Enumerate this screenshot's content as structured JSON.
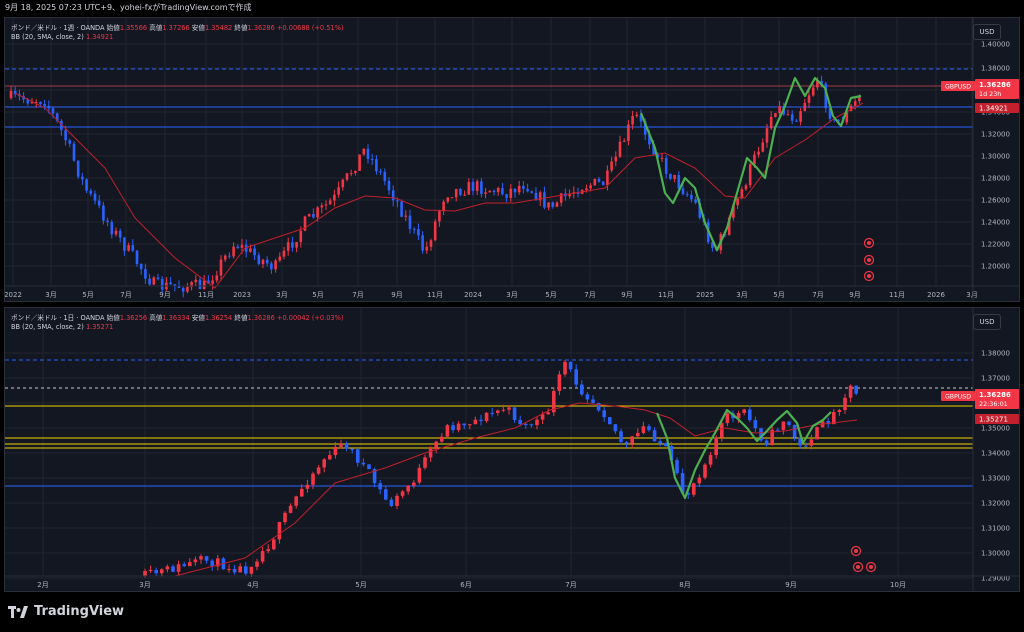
{
  "header": {
    "timestamp_text": "9月 18, 2025 07:23 UTC+9、yohei-fxがTradingView.comで作成"
  },
  "weekly": {
    "symbol_line": "ポンド／米ドル · 1週 · OANDA",
    "open_label": "始値",
    "open": "1.35566",
    "high_label": "高値",
    "high": "1.37266",
    "low_label": "安値",
    "low": "1.35482",
    "close_label": "終値",
    "close": "1.36286",
    "change": "+0.00688 (+0.51%)",
    "indicator_name": "BB (20, SMA, close, 2)",
    "indicator_value": "1.34921",
    "currency": "USD",
    "price_ticks": [
      "1.40000",
      "1.38000",
      "1.36000",
      "1.34000",
      "1.32000",
      "1.30000",
      "1.28000",
      "1.26000",
      "1.24000",
      "1.22000",
      "1.20000"
    ],
    "time_ticks": [
      "2022",
      "3月",
      "5月",
      "7月",
      "9月",
      "11月",
      "2023",
      "3月",
      "5月",
      "7月",
      "9月",
      "11月",
      "2024",
      "3月",
      "5月",
      "7月",
      "9月",
      "11月",
      "2025",
      "3月",
      "5月",
      "7月",
      "9月",
      "11月",
      "2026",
      "3月"
    ],
    "tag_symbol": "GBPUSD",
    "tag_price": "1.36286",
    "tag_countdown": "1d 23h",
    "tag_bb": "1.34921"
  },
  "daily": {
    "symbol_line": "ポンド／米ドル · 1日 · OANDA",
    "open_label": "始値",
    "open": "1.36256",
    "high_label": "高値",
    "high": "1.36334",
    "low_label": "安値",
    "low": "1.36254",
    "close_label": "終値",
    "close": "1.36286",
    "change": "+0.00042 (+0.03%)",
    "indicator_name": "BB (20, SMA, close, 2)",
    "indicator_value": "1.35271",
    "currency": "USD",
    "price_ticks": [
      "1.38000",
      "1.37000",
      "1.36000",
      "1.35000",
      "1.34000",
      "1.33000",
      "1.32000",
      "1.31000",
      "1.30000",
      "1.29000"
    ],
    "time_ticks": [
      "2月",
      "3月",
      "4月",
      "5月",
      "6月",
      "7月",
      "8月",
      "9月",
      "10月"
    ],
    "tag_symbol": "GBPUSD",
    "tag_price": "1.36286",
    "tag_countdown": "22:36:01",
    "tag_bb": "1.35271"
  },
  "footer": {
    "brand": "TradingView"
  },
  "colors": {
    "up": "#f23645",
    "down": "#2962ff",
    "bb": "#c2202c",
    "pattern": "#4caf50",
    "level_blue": "#2962ff",
    "level_yellow": "#f0d000",
    "bg": "#131722"
  }
}
